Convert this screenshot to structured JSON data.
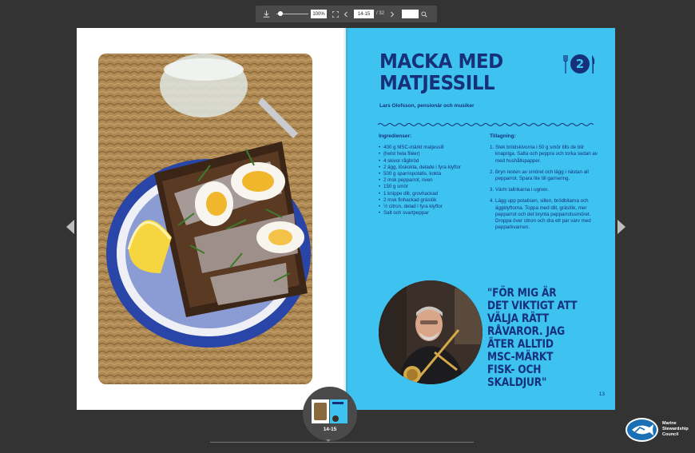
{
  "toolbar": {
    "zoom": "100%",
    "page": "14-15",
    "page_total": "/ 32",
    "search_value": "",
    "icons": [
      "download-icon",
      "fullscreen-icon",
      "chevron-left-icon",
      "chevron-right-icon",
      "search-icon"
    ]
  },
  "recipe": {
    "title_line1": "MACKA MED",
    "title_line2": "MATJESSILL",
    "number": "2",
    "byline": "Lars Olofsson, pensionär och musiker",
    "ingredients_heading": "Ingredienser:",
    "ingredients": [
      "400 g MSC-märkt matjessill",
      "(helst hela filéer)",
      "4 skivor rågbröd",
      "2 ägg, löskokta, delade i fyra klyftor",
      "500 g sparrispotatis, kokta",
      "2 msk pepparrot, riven",
      "150 g smör",
      "1 knippe dill, grovhackad",
      "2 msk finhackad gräslök",
      "½ citron, delad i fyra klyftor",
      "Salt och svartpeppar"
    ],
    "prep_heading": "Tillagning:",
    "steps": [
      {
        "n": "1.",
        "text": "Stek brödskivorna i 50 g smör tills de blir knapriga. Salta och peppra och torka sedan av med hushållspapper."
      },
      {
        "n": "2.",
        "text": "Bryn resten av smöret och lägg i nästan all pepparrot. Spara lite till garnering."
      },
      {
        "n": "3.",
        "text": "Värm tallrikarna i ugnen."
      },
      {
        "n": "4.",
        "text": "Lägg upp potatisen, sillen, brödbitarna och äggklyftorna. Toppa med dill, gräslök, mer pepparrot och det brynta pepparrotssmöret. Droppa över citron och dra ett par varv med pepparkvarnen."
      }
    ],
    "quote": "\"FÖR MIG ÄR DET VIKTIGT ATT VÄLJA RÄTT RÅVAROR. JAG ÄTER ALLTID MSC-MÄRKT FISK- OCH SKALDJUR\"",
    "page_number": "13"
  },
  "thumbnail": {
    "label": "14-15"
  },
  "logo": {
    "line1": "Marine",
    "line2": "Stewardship",
    "line3": "Council"
  },
  "colors": {
    "background": "#333333",
    "page_blue": "#3ec3f0",
    "ink_navy": "#16307a"
  }
}
